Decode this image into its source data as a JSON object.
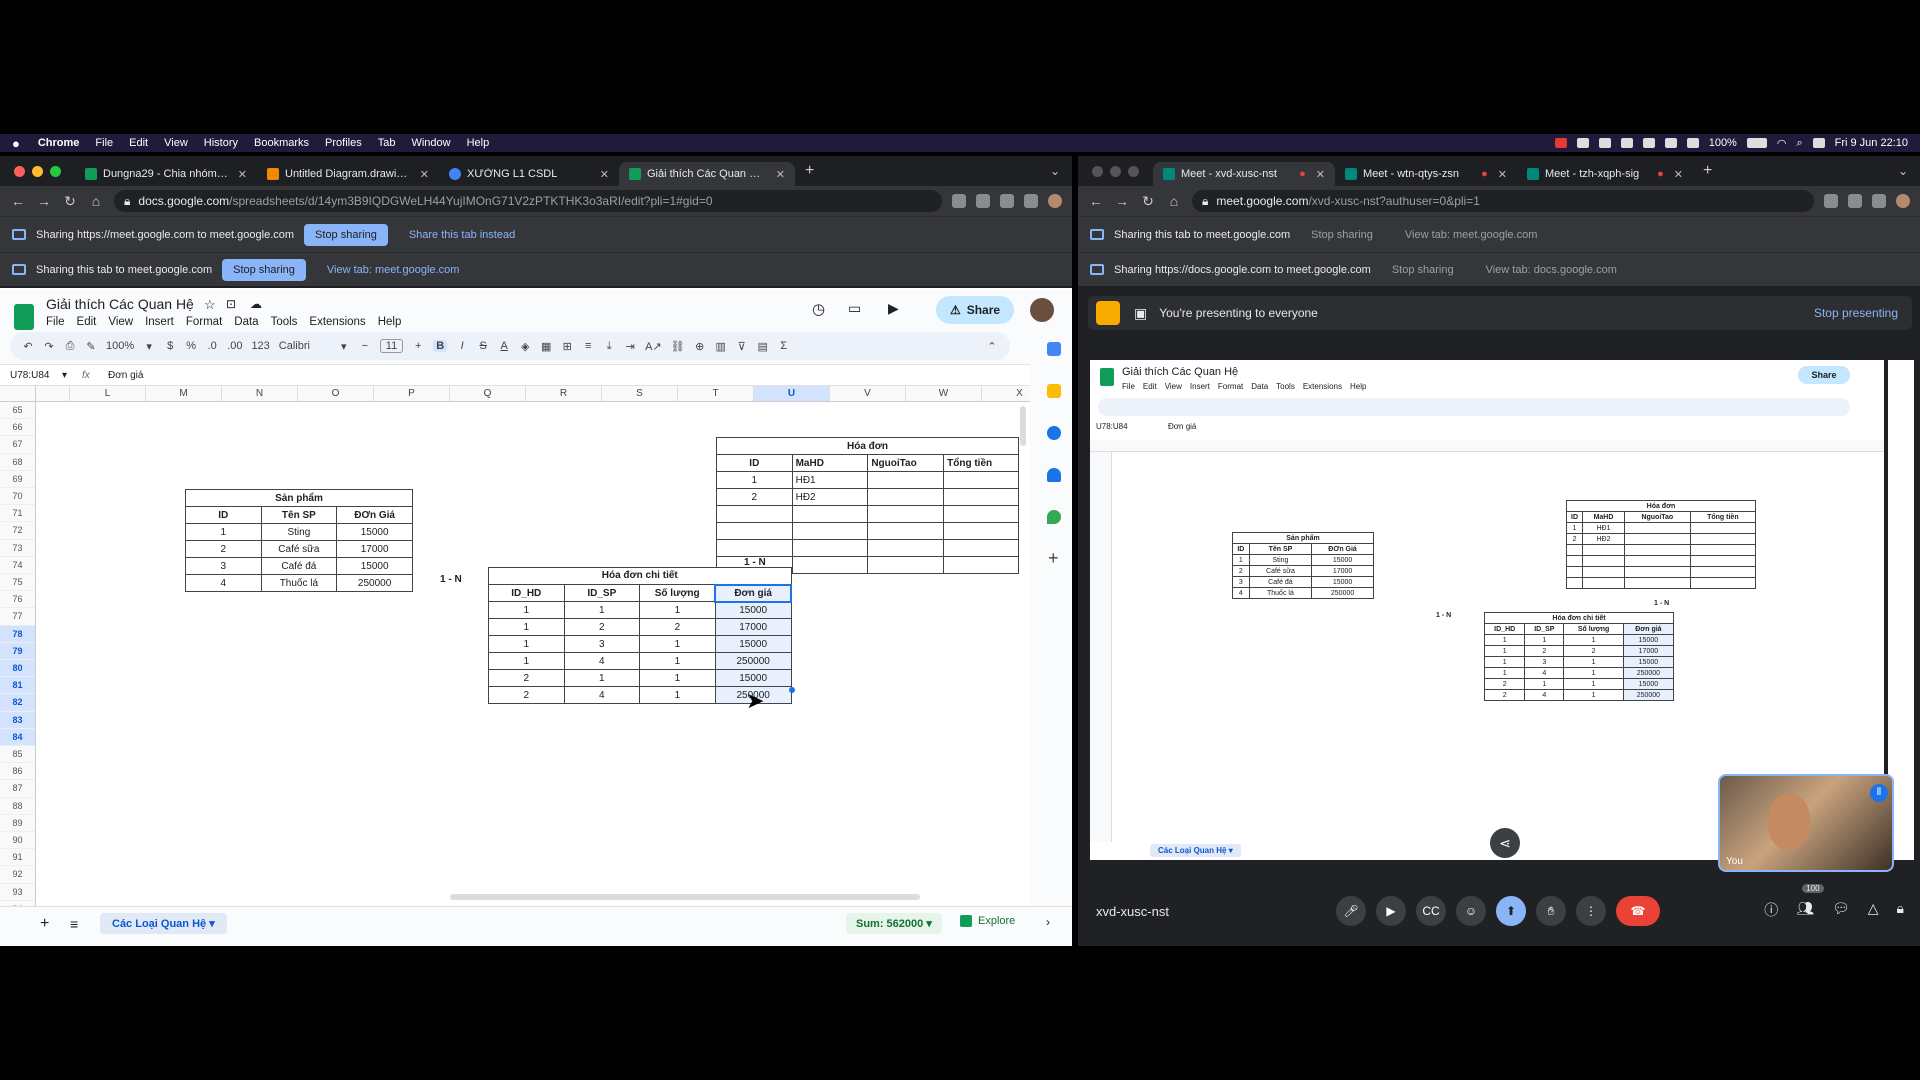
{
  "menubar": {
    "app": "Chrome",
    "items": [
      "File",
      "Edit",
      "View",
      "History",
      "Bookmarks",
      "Profiles",
      "Tab",
      "Window",
      "Help"
    ],
    "battery": "100%",
    "datetime": "Fri 9 Jun  22:10"
  },
  "left_window": {
    "tabs": [
      {
        "title": "Dungna29 - Chia nhóm DSSV",
        "color": "#0f9d58"
      },
      {
        "title": "Untitled Diagram.drawio - draw",
        "color": "#f08705"
      },
      {
        "title": "XƯỞNG L1 CSDL",
        "color": "#4285f4"
      },
      {
        "title": "Giải thích Các Quan Hệ - G",
        "color": "#0f9d58"
      }
    ],
    "url_host": "docs.google.com",
    "url_path": "/spreadsheets/d/14ym3B9IQDGWeLH44YujIMOnG71V2zPTKTHK3o3aRI/edit?pli=1#gid=0",
    "share_bar_1": {
      "text": "Sharing https://meet.google.com to meet.google.com",
      "stop": "Stop sharing",
      "alt": "Share this tab instead"
    },
    "share_bar_2": {
      "text": "Sharing this tab to meet.google.com",
      "stop": "Stop sharing",
      "alt": "View tab: meet.google.com"
    }
  },
  "sheet": {
    "title": "Giải thích Các Quan Hệ",
    "menus": [
      "File",
      "Edit",
      "View",
      "Insert",
      "Format",
      "Data",
      "Tools",
      "Extensions",
      "Help"
    ],
    "share_label": "Share",
    "zoom": "100%",
    "font": "Calibri",
    "font_size": "11",
    "name_box": "U78:U84",
    "formula": "Đơn giá",
    "columns": [
      "L",
      "M",
      "N",
      "O",
      "P",
      "Q",
      "R",
      "S",
      "T",
      "U",
      "V",
      "W",
      "X"
    ],
    "rows": [
      "65",
      "66",
      "67",
      "68",
      "69",
      "70",
      "71",
      "72",
      "73",
      "74",
      "75",
      "76",
      "77",
      "78",
      "79",
      "80",
      "81",
      "82",
      "83",
      "84",
      "85",
      "86",
      "87",
      "88",
      "89",
      "90",
      "91",
      "92",
      "93",
      "94"
    ],
    "sheet_tab": "Các Loại Quan Hệ",
    "sum": "Sum: 562000",
    "explore": "Explore",
    "san_pham": {
      "title": "Sản phẩm",
      "headers": [
        "ID",
        "Tên SP",
        "ĐƠn Giá"
      ],
      "rows": [
        [
          "1",
          "Sting",
          "15000"
        ],
        [
          "2",
          "Café sữa",
          "17000"
        ],
        [
          "3",
          "Café đá",
          "15000"
        ],
        [
          "4",
          "Thuốc lá",
          "250000"
        ]
      ]
    },
    "hoa_don": {
      "title": "Hóa đơn",
      "headers": [
        "ID",
        "MaHD",
        "NguoiTao",
        "Tổng tiền"
      ],
      "rows": [
        [
          "1",
          "HĐ1",
          "",
          ""
        ],
        [
          "2",
          "HĐ2",
          "",
          ""
        ],
        [
          "",
          "",
          "",
          ""
        ],
        [
          "",
          "",
          "",
          ""
        ],
        [
          "",
          "",
          "",
          ""
        ],
        [
          "",
          "",
          "",
          ""
        ]
      ]
    },
    "chi_tiet": {
      "title": "Hóa đơn chi tiết",
      "headers": [
        "ID_HD",
        "ID_SP",
        "Số lượng",
        "Đơn giá"
      ],
      "rows": [
        [
          "1",
          "1",
          "1",
          "15000"
        ],
        [
          "1",
          "2",
          "2",
          "17000"
        ],
        [
          "1",
          "3",
          "1",
          "15000"
        ],
        [
          "1",
          "4",
          "1",
          "250000"
        ],
        [
          "2",
          "1",
          "1",
          "15000"
        ],
        [
          "2",
          "4",
          "1",
          "250000"
        ]
      ]
    },
    "rel_left": "1 - N",
    "rel_top": "1 - N"
  },
  "right_window": {
    "tabs": [
      {
        "title": "Meet - xvd-xusc-nst"
      },
      {
        "title": "Meet - wtn-qtys-zsn"
      },
      {
        "title": "Meet - tzh-xqph-sig"
      }
    ],
    "url_host": "meet.google.com",
    "url_path": "/xvd-xusc-nst?authuser=0&pli=1",
    "share_bar_1": {
      "text": "Sharing this tab to meet.google.com",
      "stop": "Stop sharing",
      "alt": "View tab: meet.google.com"
    },
    "share_bar_2": {
      "text": "Sharing https://docs.google.com to meet.google.com",
      "stop": "Stop sharing",
      "alt": "View tab: docs.google.com"
    },
    "presenting_text": "You're presenting to everyone",
    "stop_presenting": "Stop presenting",
    "meeting_code": "xvd-xusc-nst",
    "self_label": "You",
    "participants": "100"
  }
}
